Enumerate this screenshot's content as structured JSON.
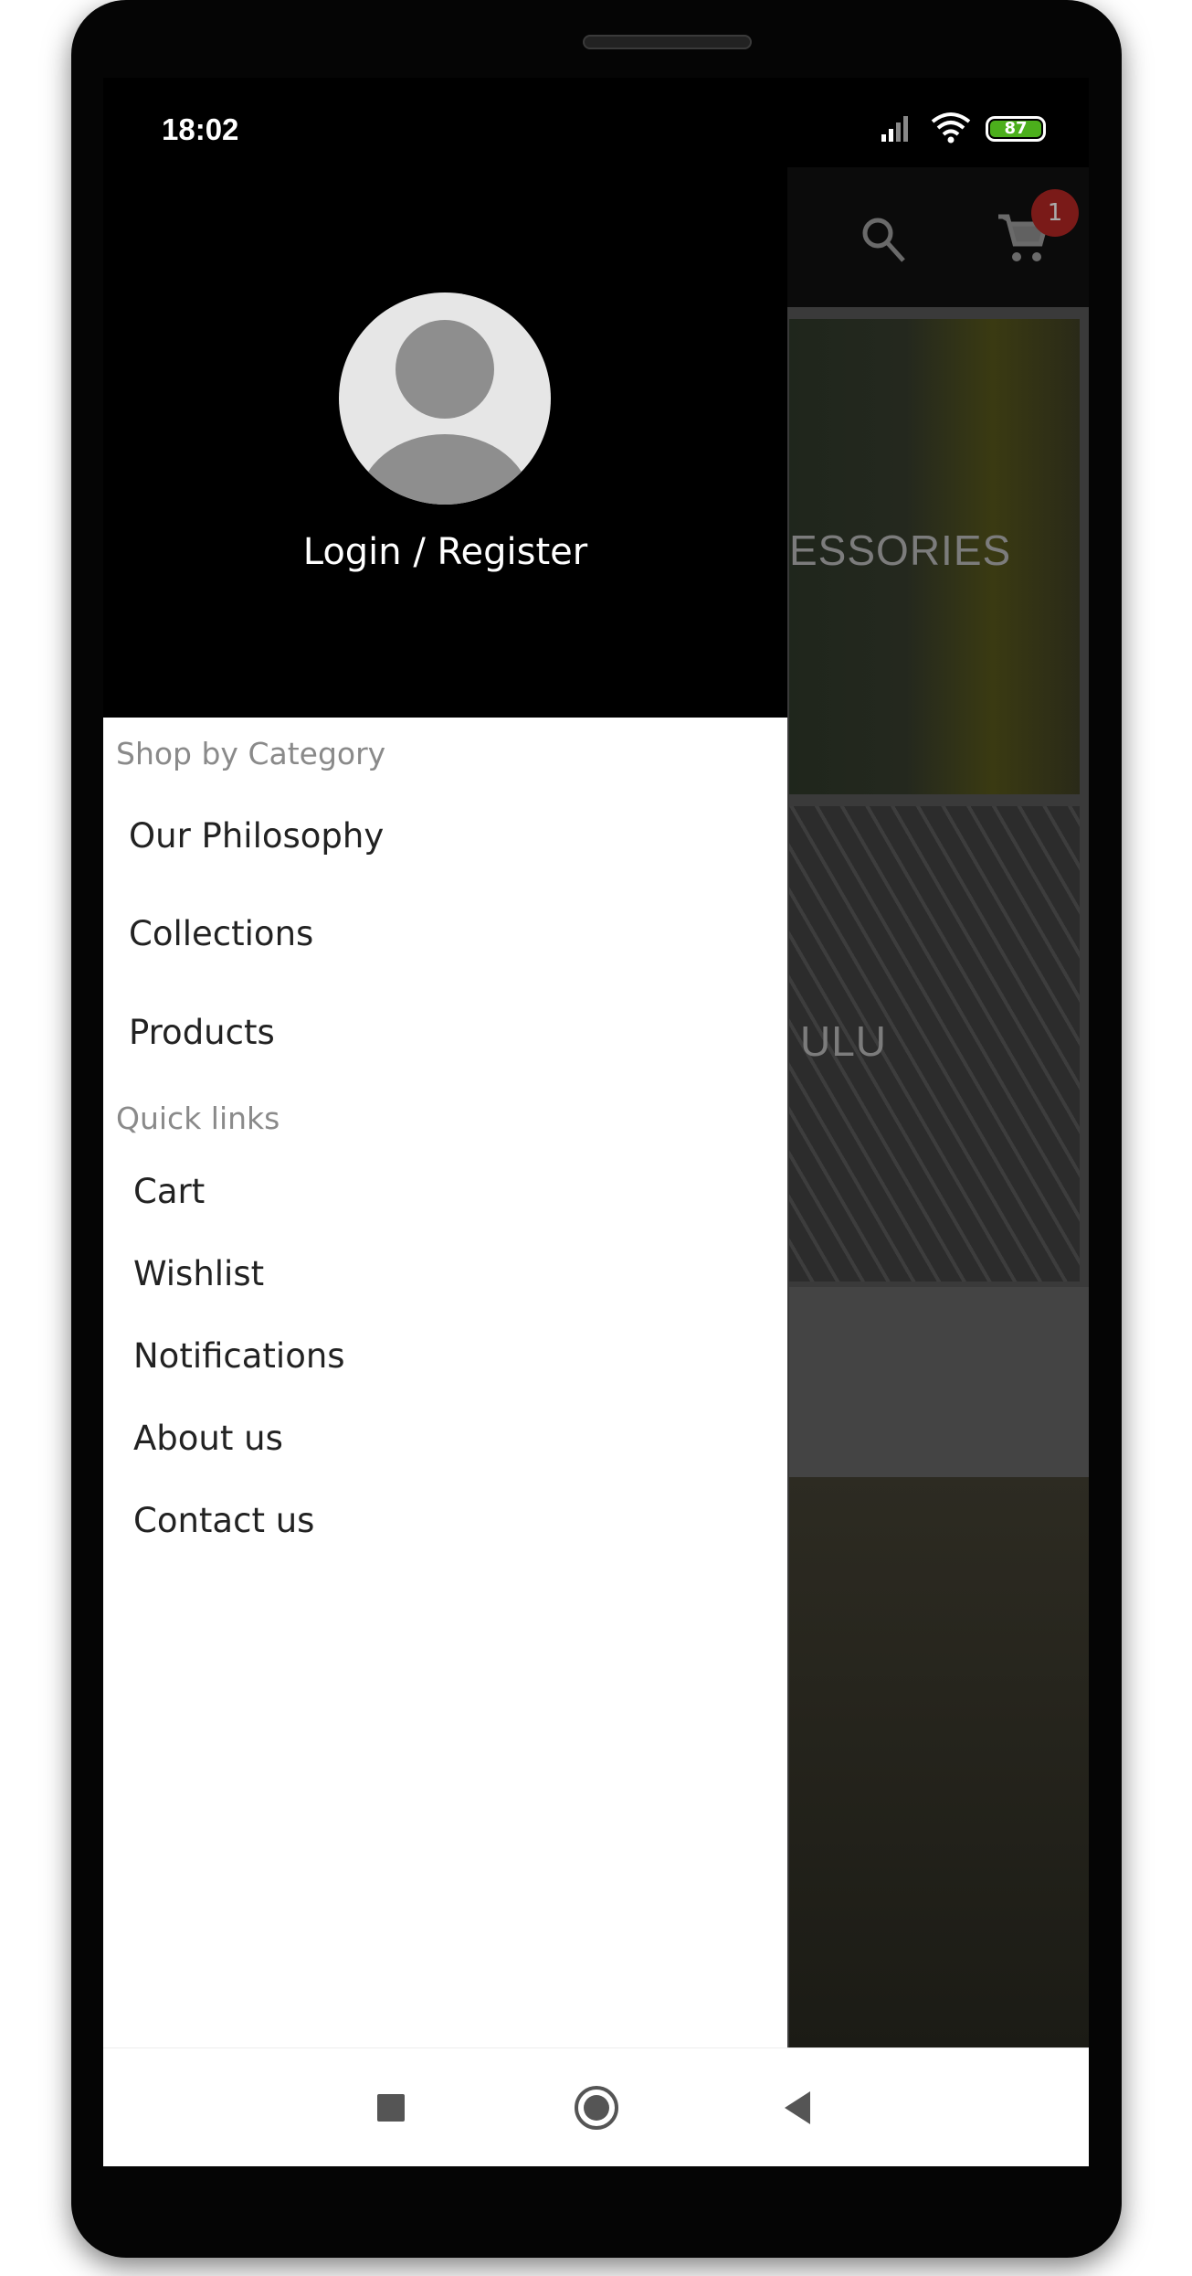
{
  "status_bar": {
    "time": "18:02",
    "battery": "87"
  },
  "app_bar": {
    "search_icon": "search-icon",
    "cart_icon": "cart-icon",
    "cart_badge": "1"
  },
  "content": {
    "tiles": [
      {
        "label": "ESSORIES"
      },
      {
        "label": "ULU"
      }
    ]
  },
  "drawer": {
    "login_label": "Login / Register",
    "sections": [
      {
        "title": "Shop by Category",
        "items": [
          "Our Philosophy",
          "Collections",
          "Products"
        ]
      },
      {
        "title": "Quick links",
        "items": [
          "Cart",
          "Wishlist",
          "Notifications",
          "About us",
          "Contact us"
        ]
      }
    ]
  },
  "colors": {
    "badge": "#7a1a18",
    "battery": "#4caf1c"
  }
}
